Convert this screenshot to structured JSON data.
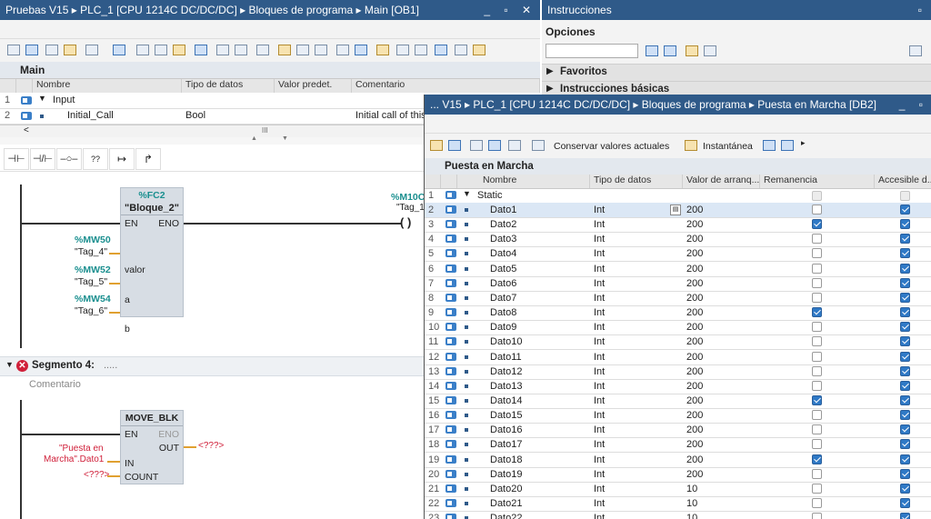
{
  "left": {
    "title": "Pruebas V15  ▸  PLC_1 [CPU 1214C DC/DC/DC]  ▸  Bloques de programa  ▸  Main [OB1]",
    "block_name": "Main",
    "columns": [
      "Nombre",
      "Tipo de datos",
      "Valor predet.",
      "Comentario"
    ],
    "rows": [
      {
        "num": "1",
        "name": "Input",
        "type": "",
        "comment": ""
      },
      {
        "num": "2",
        "name": "Initial_Call",
        "type": "Bool",
        "comment": "Initial call of this"
      }
    ],
    "scroll_glyph": "III",
    "ladder_tools": [
      "⊣⊢",
      "⊣/⊢",
      "–○–",
      "??",
      "↦",
      "↱"
    ],
    "network3": {
      "coil_addr": "%M10C",
      "coil_tag": "\"Tag_1",
      "coil_symbol": "( )",
      "block_addr": "%FC2",
      "block_name": "\"Bloque_2\"",
      "en": "EN",
      "eno": "ENO",
      "params": [
        {
          "addr": "%MW50",
          "tag": "\"Tag_4\"",
          "pin": "valor"
        },
        {
          "addr": "%MW52",
          "tag": "\"Tag_5\"",
          "pin": "a"
        },
        {
          "addr": "%MW54",
          "tag": "\"Tag_6\"",
          "pin": "b"
        }
      ]
    },
    "network4": {
      "label": "Segmento 4:",
      "dots": ".....",
      "comment": "Comentario",
      "block": "MOVE_BLK",
      "en": "EN",
      "eno": "ENO",
      "out": "OUT",
      "out_val": "<???>",
      "in": "IN",
      "in_val1": "\"Puesta en",
      "in_val2": "Marcha\".Dato1",
      "count": "COUNT",
      "count_val": "<???>"
    }
  },
  "right": {
    "title": "Instrucciones",
    "options_label": "Opciones",
    "favorites": "Favoritos",
    "basic": "Instrucciones básicas"
  },
  "db": {
    "title": "... V15  ▸  PLC_1 [CPU 1214C DC/DC/DC]  ▸  Bloques de programa  ▸  Puesta en Marcha [DB2]",
    "keep_values": "Conservar valores actuales",
    "snapshot": "Instantánea",
    "name": "Puesta en Marcha",
    "columns": [
      "Nombre",
      "Tipo de datos",
      "Valor de arranq...",
      "Remanencia",
      "Accesible d..."
    ],
    "static_row": {
      "num": "1",
      "name": "Static"
    },
    "rows": [
      {
        "num": "2",
        "name": "Dato1",
        "type": "Int",
        "value": "200",
        "rem": false,
        "acc": true
      },
      {
        "num": "3",
        "name": "Dato2",
        "type": "Int",
        "value": "200",
        "rem": true,
        "acc": true
      },
      {
        "num": "4",
        "name": "Dato3",
        "type": "Int",
        "value": "200",
        "rem": false,
        "acc": true
      },
      {
        "num": "5",
        "name": "Dato4",
        "type": "Int",
        "value": "200",
        "rem": false,
        "acc": true
      },
      {
        "num": "6",
        "name": "Dato5",
        "type": "Int",
        "value": "200",
        "rem": false,
        "acc": true
      },
      {
        "num": "7",
        "name": "Dato6",
        "type": "Int",
        "value": "200",
        "rem": false,
        "acc": true
      },
      {
        "num": "8",
        "name": "Dato7",
        "type": "Int",
        "value": "200",
        "rem": false,
        "acc": true
      },
      {
        "num": "9",
        "name": "Dato8",
        "type": "Int",
        "value": "200",
        "rem": true,
        "acc": true
      },
      {
        "num": "10",
        "name": "Dato9",
        "type": "Int",
        "value": "200",
        "rem": false,
        "acc": true
      },
      {
        "num": "11",
        "name": "Dato10",
        "type": "Int",
        "value": "200",
        "rem": false,
        "acc": true
      },
      {
        "num": "12",
        "name": "Dato11",
        "type": "Int",
        "value": "200",
        "rem": false,
        "acc": true
      },
      {
        "num": "13",
        "name": "Dato12",
        "type": "Int",
        "value": "200",
        "rem": false,
        "acc": true
      },
      {
        "num": "14",
        "name": "Dato13",
        "type": "Int",
        "value": "200",
        "rem": false,
        "acc": true
      },
      {
        "num": "15",
        "name": "Dato14",
        "type": "Int",
        "value": "200",
        "rem": true,
        "acc": true
      },
      {
        "num": "16",
        "name": "Dato15",
        "type": "Int",
        "value": "200",
        "rem": false,
        "acc": true
      },
      {
        "num": "17",
        "name": "Dato16",
        "type": "Int",
        "value": "200",
        "rem": false,
        "acc": true
      },
      {
        "num": "18",
        "name": "Dato17",
        "type": "Int",
        "value": "200",
        "rem": false,
        "acc": true
      },
      {
        "num": "19",
        "name": "Dato18",
        "type": "Int",
        "value": "200",
        "rem": true,
        "acc": true
      },
      {
        "num": "20",
        "name": "Dato19",
        "type": "Int",
        "value": "200",
        "rem": false,
        "acc": true
      },
      {
        "num": "21",
        "name": "Dato20",
        "type": "Int",
        "value": "10",
        "rem": false,
        "acc": true
      },
      {
        "num": "22",
        "name": "Dato21",
        "type": "Int",
        "value": "10",
        "rem": false,
        "acc": true
      },
      {
        "num": "23",
        "name": "Dato22",
        "type": "Int",
        "value": "10",
        "rem": false,
        "acc": true
      }
    ]
  },
  "colors": {
    "titlebar": "#2f5a89",
    "accent": "#2f79c6",
    "tag_green": "#1a8f8f",
    "error_red": "#d0203a"
  }
}
